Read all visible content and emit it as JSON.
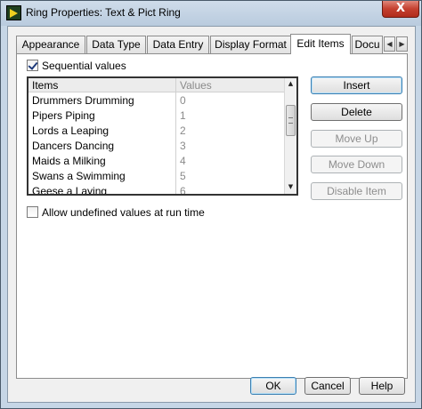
{
  "window": {
    "title": "Ring Properties: Text & Pict Ring",
    "close_label": "X"
  },
  "tabs": [
    {
      "label": "Appearance",
      "active": false
    },
    {
      "label": "Data Type",
      "active": false
    },
    {
      "label": "Data Entry",
      "active": false
    },
    {
      "label": "Display Format",
      "active": false
    },
    {
      "label": "Edit Items",
      "active": true
    },
    {
      "label": "Docu",
      "active": false
    }
  ],
  "tab_scroll": {
    "left": "◀",
    "right": "▶"
  },
  "sequential": {
    "label": "Sequential values",
    "checked": true
  },
  "list": {
    "headers": {
      "items": "Items",
      "values": "Values"
    },
    "rows": [
      {
        "item": "Drummers Drumming",
        "value": "0"
      },
      {
        "item": "Pipers Piping",
        "value": "1"
      },
      {
        "item": "Lords a Leaping",
        "value": "2"
      },
      {
        "item": "Dancers Dancing",
        "value": "3"
      },
      {
        "item": "Maids a Milking",
        "value": "4"
      },
      {
        "item": "Swans a Swimming",
        "value": "5"
      },
      {
        "item": "Geese a Laying",
        "value": "6"
      }
    ],
    "scroll_up": "▲",
    "scroll_down": "▼"
  },
  "actions": {
    "insert": "Insert",
    "delete": "Delete",
    "move_up": "Move Up",
    "move_down": "Move Down",
    "disable_item": "Disable Item"
  },
  "allow_undefined": {
    "label": "Allow undefined values at run time",
    "checked": false
  },
  "footer": {
    "ok": "OK",
    "cancel": "Cancel",
    "help": "Help"
  }
}
